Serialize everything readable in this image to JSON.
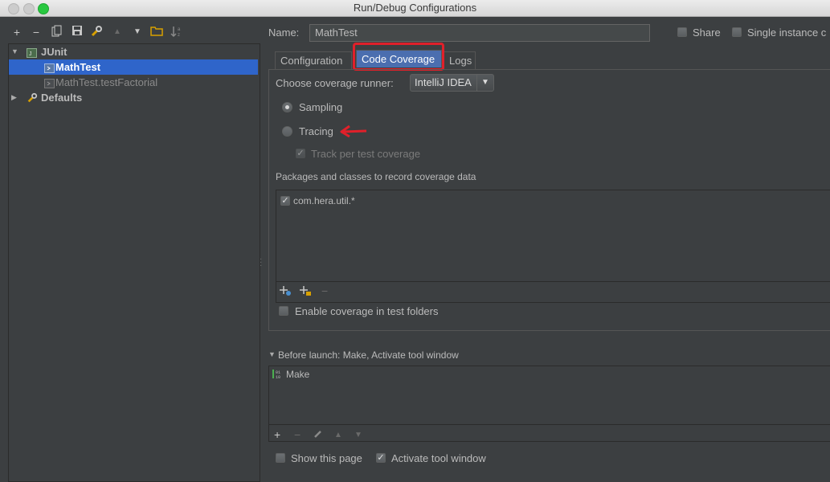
{
  "window": {
    "title": "Run/Debug Configurations"
  },
  "toolbar": {
    "add": "+",
    "remove": "−",
    "copy_icon": "copy-icon",
    "save_icon": "save-icon",
    "edit_defaults_icon": "wrench-icon",
    "move_up": "▲",
    "move_down": "▼",
    "folder_icon": "folder-icon",
    "sort_icon": "sort-icon"
  },
  "tree": {
    "items": [
      {
        "label": "JUnit",
        "expanded": true
      },
      {
        "label": "MathTest",
        "selected": true
      },
      {
        "label": "MathTest.testFactorial"
      },
      {
        "label": "Defaults",
        "expanded": false
      }
    ]
  },
  "config": {
    "name_label": "Name:",
    "name_value": "MathTest",
    "share_label": "Share",
    "single_instance_label": "Single instance c"
  },
  "tabs": [
    {
      "label": "Configuration"
    },
    {
      "label": "Code Coverage",
      "active": true
    },
    {
      "label": "Logs"
    }
  ],
  "coverage": {
    "runner_label": "Choose coverage runner:",
    "runner_value": "IntelliJ IDEA",
    "sampling_label": "Sampling",
    "tracing_label": "Tracing",
    "track_label": "Track per test coverage",
    "packages_label": "Packages and classes to record coverage data",
    "packages": [
      "com.hera.util.*"
    ],
    "enable_test_folders_label": "Enable coverage in test folders"
  },
  "before_launch": {
    "header": "Before launch: Make, Activate tool window",
    "items": [
      "Make"
    ]
  },
  "footer": {
    "show_page_label": "Show this page",
    "activate_label": "Activate tool window"
  },
  "colors": {
    "background": "#3c3f41",
    "selection": "#2f65ca",
    "active_tab": "#4b6eaf",
    "highlight": "#e0202a"
  }
}
